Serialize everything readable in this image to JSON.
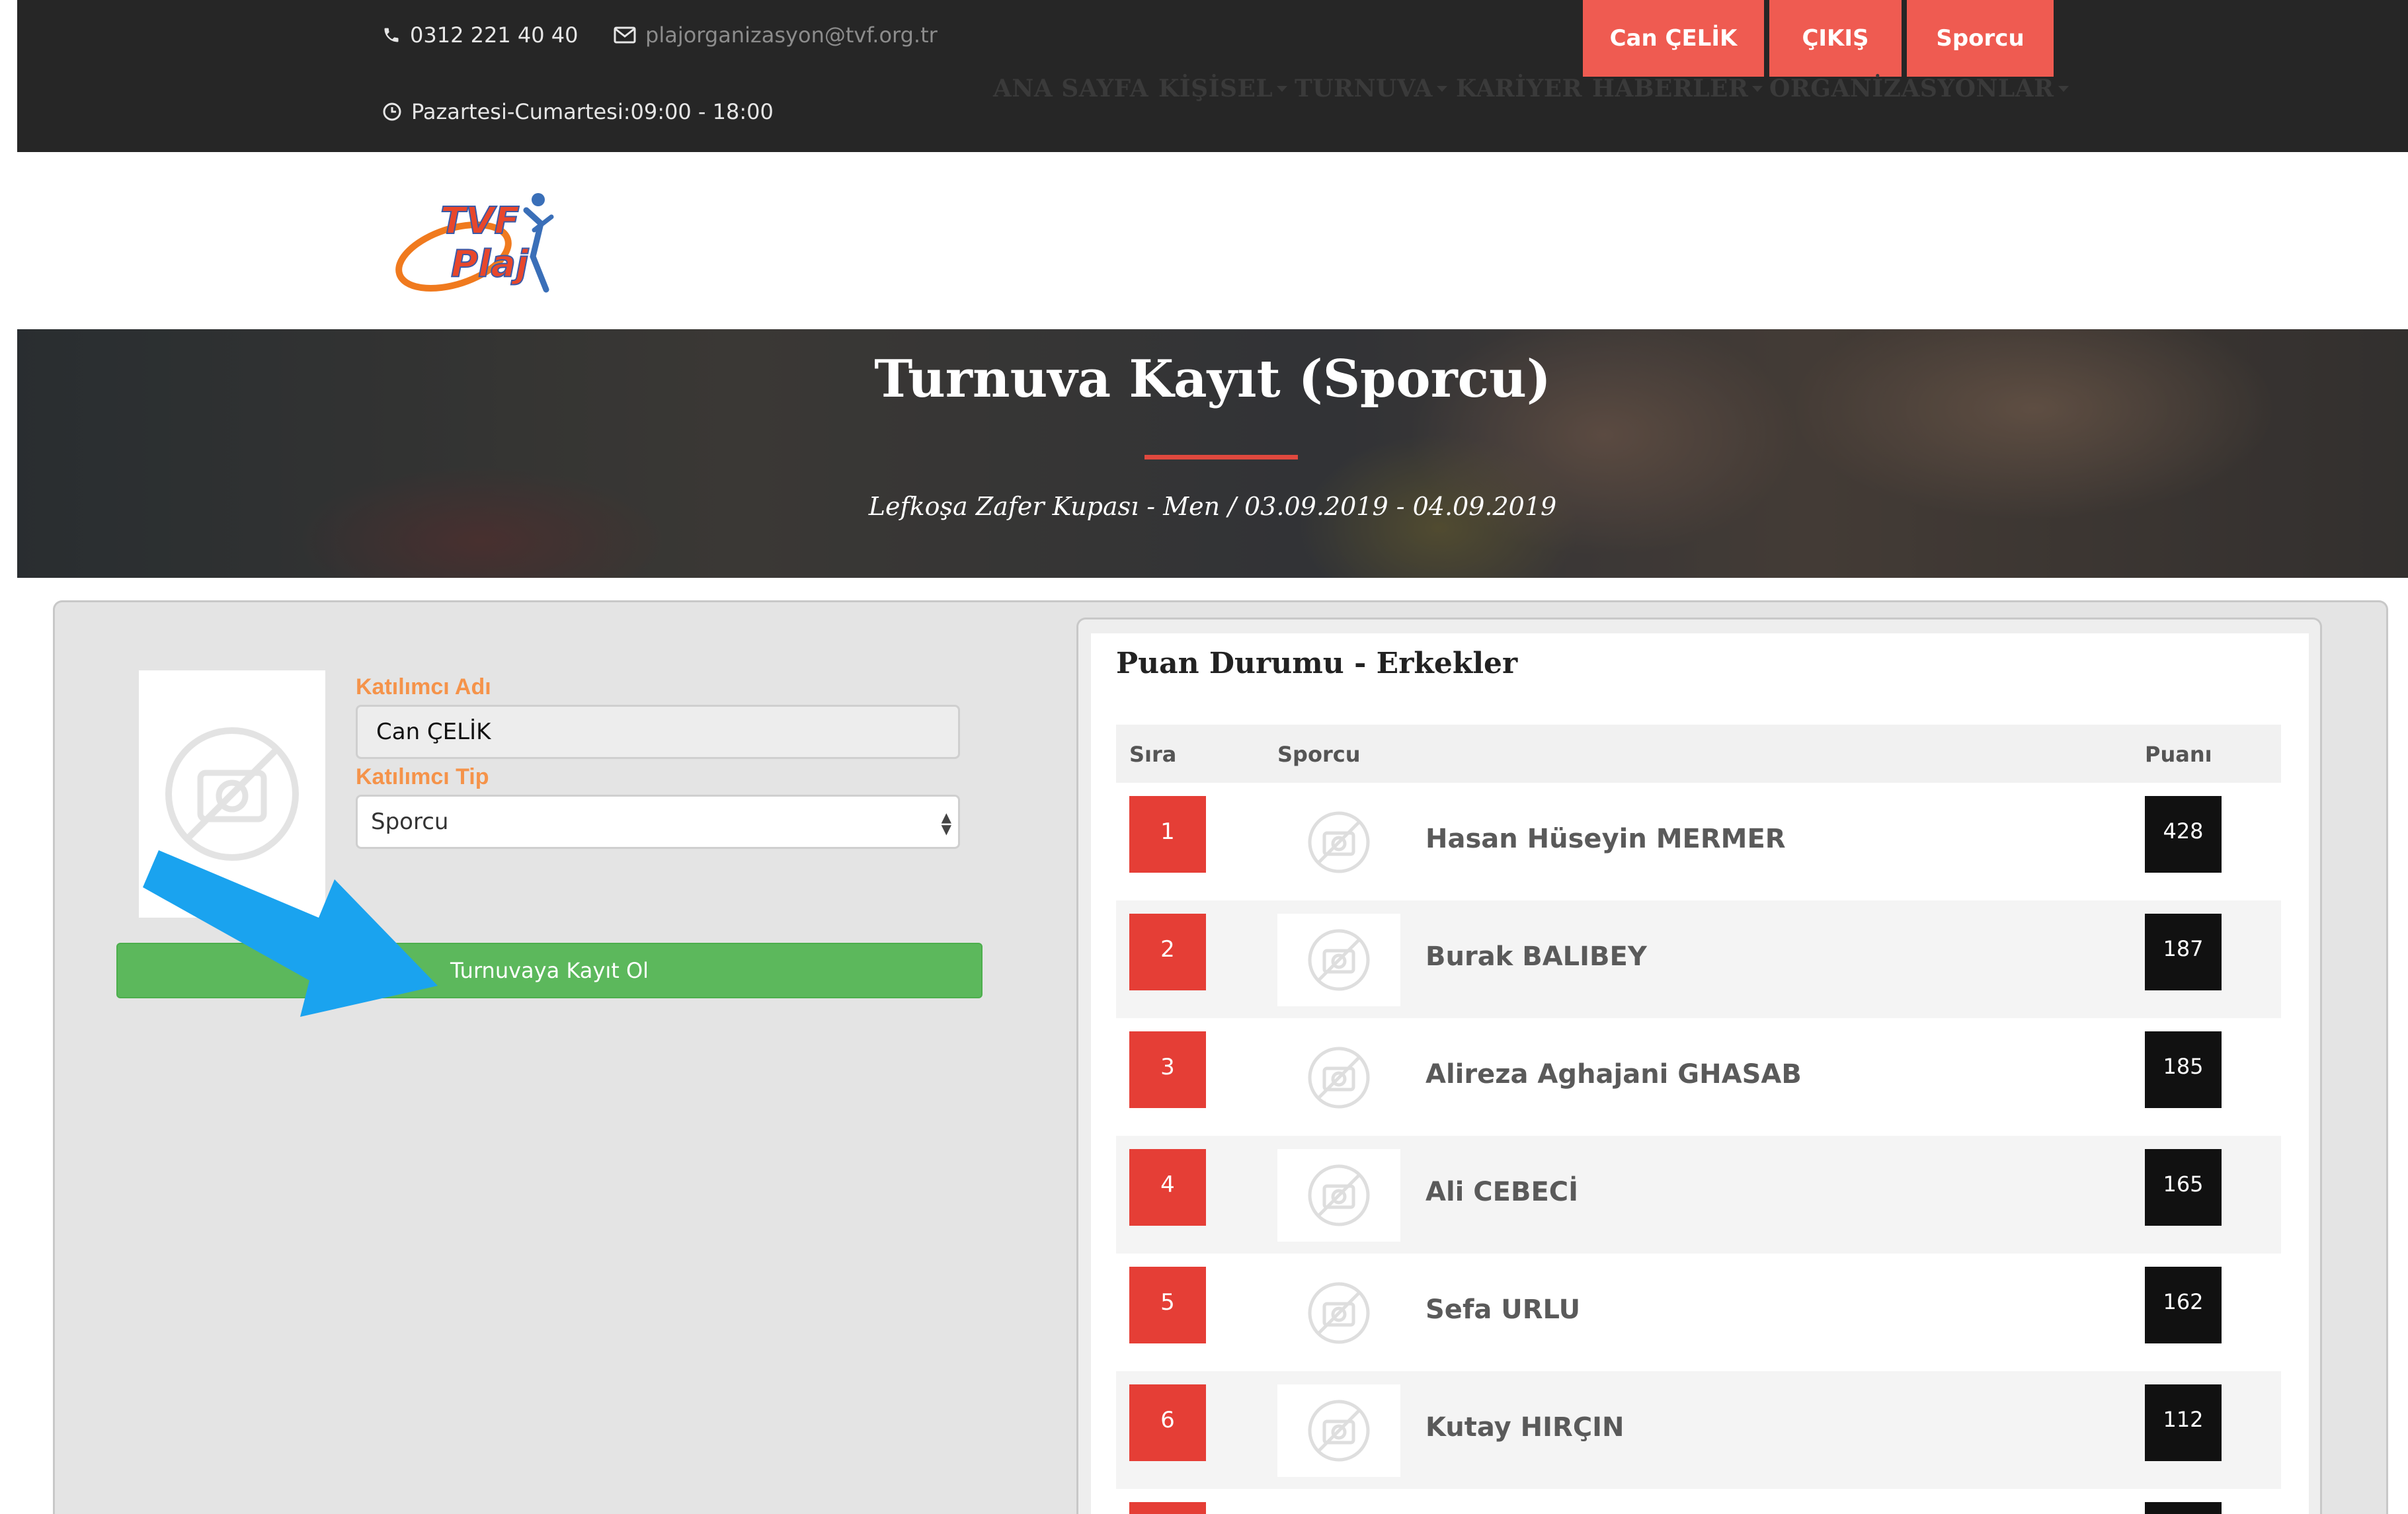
{
  "topbar": {
    "phone": "0312 221 40 40",
    "email": "plajorganizasyon@tvf.org.tr",
    "hours": "Pazartesi-Cumartesi:09:00 - 18:00",
    "buttons": {
      "user": "Can ÇELİK",
      "logout": "ÇIKIŞ",
      "role": "Sporcu"
    }
  },
  "logo": {
    "line1": "TVF",
    "line2": "Plaj"
  },
  "nav": {
    "home": "ANA SAYFA",
    "personal": "KİŞİSEL",
    "tournament": "TURNUVA",
    "career": "KARİYER",
    "news": "HABERLER",
    "organizations": "ORGANİZASYONLAR"
  },
  "hero": {
    "title": "Turnuva Kayıt (Sporcu)",
    "subtitle": "Lefkoşa Zafer Kupası - Men / 03.09.2019 - 04.09.2019"
  },
  "form": {
    "participant_name_label": "Katılımcı Adı",
    "participant_name_value": "Can ÇELİK",
    "participant_type_label": "Katılımcı Tip",
    "participant_type_value": "Sporcu",
    "register_button": "Turnuvaya Kayıt Ol"
  },
  "standings": {
    "title": "Puan Durumu - Erkekler",
    "headers": {
      "rank": "Sıra",
      "athlete": "Sporcu",
      "points": "Puanı"
    },
    "rows": [
      {
        "rank": "1",
        "name": "Hasan Hüseyin MERMER",
        "points": "428"
      },
      {
        "rank": "2",
        "name": "Burak BALIBEY",
        "points": "187"
      },
      {
        "rank": "3",
        "name": "Alireza Aghajani GHASAB",
        "points": "185"
      },
      {
        "rank": "4",
        "name": "Ali CEBECİ",
        "points": "165"
      },
      {
        "rank": "5",
        "name": "Sefa URLU",
        "points": "162"
      },
      {
        "rank": "6",
        "name": "Kutay HIRÇIN",
        "points": "112"
      }
    ]
  },
  "colors": {
    "topbar_bg": "#262626",
    "accent_red": "#ef5b51",
    "label_orange": "#f5934a",
    "success_green": "#5cb85c",
    "annotation_arrow": "#1aa3ef"
  }
}
